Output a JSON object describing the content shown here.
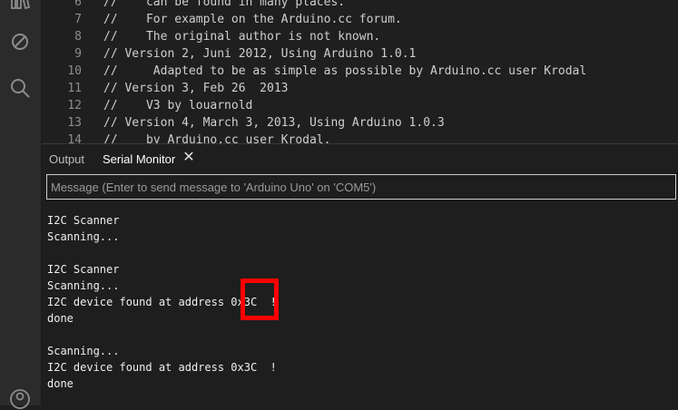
{
  "activity_bar": {
    "icons": [
      "library-icon",
      "debug-icon",
      "search-icon",
      "account-icon"
    ]
  },
  "editor": {
    "lines": [
      {
        "num": "6",
        "text": "//    can be found in many places."
      },
      {
        "num": "7",
        "text": "//    For example on the Arduino.cc forum."
      },
      {
        "num": "8",
        "text": "//    The original author is not known."
      },
      {
        "num": "9",
        "text": "// Version 2, Juni 2012, Using Arduino 1.0.1"
      },
      {
        "num": "10",
        "text": "//     Adapted to be as simple as possible by Arduino.cc user Krodal"
      },
      {
        "num": "11",
        "text": "// Version 3, Feb 26  2013"
      },
      {
        "num": "12",
        "text": "//    V3 by louarnold"
      },
      {
        "num": "13",
        "text": "// Version 4, March 3, 2013, Using Arduino 1.0.3"
      },
      {
        "num": "14",
        "text": "//    by Arduino.cc user Krodal."
      }
    ]
  },
  "panel": {
    "tabs": [
      {
        "label": "Output"
      },
      {
        "label": "Serial Monitor"
      }
    ],
    "close_glyph": "✕",
    "message_placeholder": "Message (Enter to send message to 'Arduino Uno' on 'COM5')"
  },
  "serial_output": {
    "lines": [
      "I2C Scanner",
      "Scanning...",
      "",
      "I2C Scanner",
      "Scanning...",
      "I2C device found at address 0x3C  !",
      "done",
      "",
      "Scanning...",
      "I2C device found at address 0x3C  !",
      "done"
    ]
  },
  "colors": {
    "highlight": "#ff0000",
    "background": "#1e1e1e"
  }
}
